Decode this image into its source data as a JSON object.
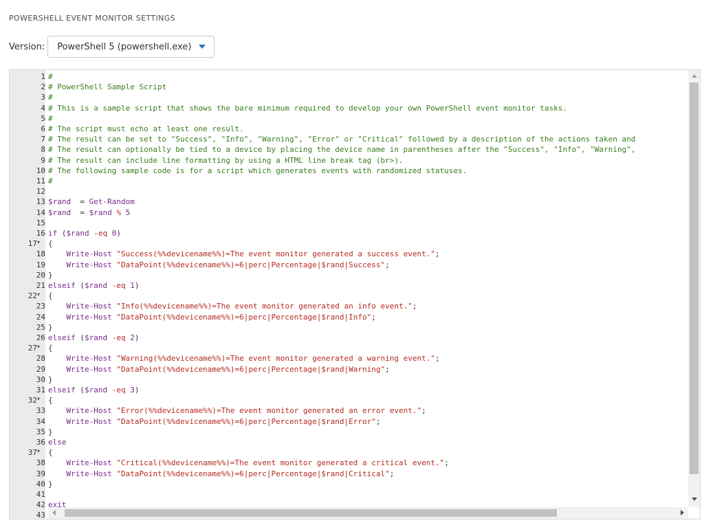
{
  "section_title": "POWERSHELL EVENT MONITOR SETTINGS",
  "version": {
    "label": "Version:",
    "selected": "PowerShell 5 (powershell.exe)"
  },
  "editor": {
    "line_numbers": [
      "1",
      "2",
      "3",
      "4",
      "5",
      "6",
      "7",
      "8",
      "9",
      "10",
      "11",
      "12",
      "13",
      "14",
      "15",
      "16",
      "17",
      "18",
      "19",
      "20",
      "21",
      "22",
      "23",
      "24",
      "25",
      "26",
      "27",
      "28",
      "29",
      "30",
      "31",
      "32",
      "33",
      "34",
      "35",
      "36",
      "37",
      "38",
      "39",
      "40",
      "41",
      "42",
      "43"
    ],
    "fold_lines": [
      17,
      22,
      27,
      32,
      37
    ],
    "fold_glyph": "▾",
    "lines": [
      [
        [
          "c-com",
          "#"
        ]
      ],
      [
        [
          "c-com",
          "# PowerShell Sample Script"
        ]
      ],
      [
        [
          "c-com",
          "#"
        ]
      ],
      [
        [
          "c-com",
          "# This is a sample script that shows the bare minimum required to develop your own PowerShell event monitor tasks."
        ]
      ],
      [
        [
          "c-com",
          "#"
        ]
      ],
      [
        [
          "c-com",
          "# The script must echo at least one result."
        ]
      ],
      [
        [
          "c-com",
          "# The result can be set to \"Success\", \"Info\", \"Warning\", \"Error\" or \"Critical\" followed by a description of the actions taken and"
        ]
      ],
      [
        [
          "c-com",
          "# The result can optionally be tied to a device by placing the device name in parentheses after the \"Success\", \"Info\", \"Warning\","
        ]
      ],
      [
        [
          "c-com",
          "# The result can include line formatting by using a HTML line break tag (br>)."
        ]
      ],
      [
        [
          "c-com",
          "# The following sample code is for a script which generates events with randomized statuses."
        ]
      ],
      [
        [
          "c-com",
          "#"
        ]
      ],
      [],
      [
        [
          "c-var",
          "$rand"
        ],
        [
          "",
          "  = "
        ],
        [
          "c-fn",
          "Get-Random"
        ]
      ],
      [
        [
          "c-var",
          "$rand"
        ],
        [
          "",
          "  = "
        ],
        [
          "c-var",
          "$rand"
        ],
        [
          "c-op",
          " %"
        ],
        [
          "c-num",
          " 5"
        ]
      ],
      [],
      [
        [
          "c-kw",
          "if"
        ],
        [
          "",
          " ("
        ],
        [
          "c-var",
          "$rand"
        ],
        [
          "c-op",
          " -eq"
        ],
        [
          "c-num",
          " 0"
        ],
        [
          "",
          ")"
        ]
      ],
      [
        [
          "",
          "{"
        ]
      ],
      [
        [
          "",
          "    "
        ],
        [
          "c-fn",
          "Write-Host"
        ],
        [
          "c-str",
          " \"Success(%%devicename%%)=The event monitor generated a success event.\""
        ],
        [
          "",
          ";"
        ]
      ],
      [
        [
          "",
          "    "
        ],
        [
          "c-fn",
          "Write-Host"
        ],
        [
          "c-str",
          " \"DataPoint(%%devicename%%)=6|perc|Percentage|$rand|Success\""
        ],
        [
          "",
          ";"
        ]
      ],
      [
        [
          "",
          "}"
        ]
      ],
      [
        [
          "c-kw",
          "elseif"
        ],
        [
          "",
          " ("
        ],
        [
          "c-var",
          "$rand"
        ],
        [
          "c-op",
          " -eq"
        ],
        [
          "c-num",
          " 1"
        ],
        [
          "",
          ")"
        ]
      ],
      [
        [
          "",
          "{"
        ]
      ],
      [
        [
          "",
          "    "
        ],
        [
          "c-fn",
          "Write-Host"
        ],
        [
          "c-str",
          " \"Info(%%devicename%%)=The event monitor generated an info event.\""
        ],
        [
          "",
          ";"
        ]
      ],
      [
        [
          "",
          "    "
        ],
        [
          "c-fn",
          "Write-Host"
        ],
        [
          "c-str",
          " \"DataPoint(%%devicename%%)=6|perc|Percentage|$rand|Info\""
        ],
        [
          "",
          ";"
        ]
      ],
      [
        [
          "",
          "}"
        ]
      ],
      [
        [
          "c-kw",
          "elseif"
        ],
        [
          "",
          " ("
        ],
        [
          "c-var",
          "$rand"
        ],
        [
          "c-op",
          " -eq"
        ],
        [
          "c-num",
          " 2"
        ],
        [
          "",
          ")"
        ]
      ],
      [
        [
          "",
          "{"
        ]
      ],
      [
        [
          "",
          "    "
        ],
        [
          "c-fn",
          "Write-Host"
        ],
        [
          "c-str",
          " \"Warning(%%devicename%%)=The event monitor generated a warning event.\""
        ],
        [
          "",
          ";"
        ]
      ],
      [
        [
          "",
          "    "
        ],
        [
          "c-fn",
          "Write-Host"
        ],
        [
          "c-str",
          " \"DataPoint(%%devicename%%)=6|perc|Percentage|$rand|Warning\""
        ],
        [
          "",
          ";"
        ]
      ],
      [
        [
          "",
          "}"
        ]
      ],
      [
        [
          "c-kw",
          "elseif"
        ],
        [
          "",
          " ("
        ],
        [
          "c-var",
          "$rand"
        ],
        [
          "c-op",
          " -eq"
        ],
        [
          "c-num",
          " 3"
        ],
        [
          "",
          ")"
        ]
      ],
      [
        [
          "",
          "{"
        ]
      ],
      [
        [
          "",
          "    "
        ],
        [
          "c-fn",
          "Write-Host"
        ],
        [
          "c-str",
          " \"Error(%%devicename%%)=The event monitor generated an error event.\""
        ],
        [
          "",
          ";"
        ]
      ],
      [
        [
          "",
          "    "
        ],
        [
          "c-fn",
          "Write-Host"
        ],
        [
          "c-str",
          " \"DataPoint(%%devicename%%)=6|perc|Percentage|$rand|Error\""
        ],
        [
          "",
          ";"
        ]
      ],
      [
        [
          "",
          "}"
        ]
      ],
      [
        [
          "c-kw",
          "else"
        ]
      ],
      [
        [
          "",
          "{"
        ]
      ],
      [
        [
          "",
          "    "
        ],
        [
          "c-fn",
          "Write-Host"
        ],
        [
          "c-str",
          " \"Critical(%%devicename%%)=The event monitor generated a critical event.\""
        ],
        [
          "",
          ";"
        ]
      ],
      [
        [
          "",
          "    "
        ],
        [
          "c-fn",
          "Write-Host"
        ],
        [
          "c-str",
          " \"DataPoint(%%devicename%%)=6|perc|Percentage|$rand|Critical\""
        ],
        [
          "",
          ";"
        ]
      ],
      [
        [
          "",
          "}"
        ]
      ],
      [],
      [
        [
          "c-kw",
          "exit"
        ]
      ],
      []
    ]
  }
}
